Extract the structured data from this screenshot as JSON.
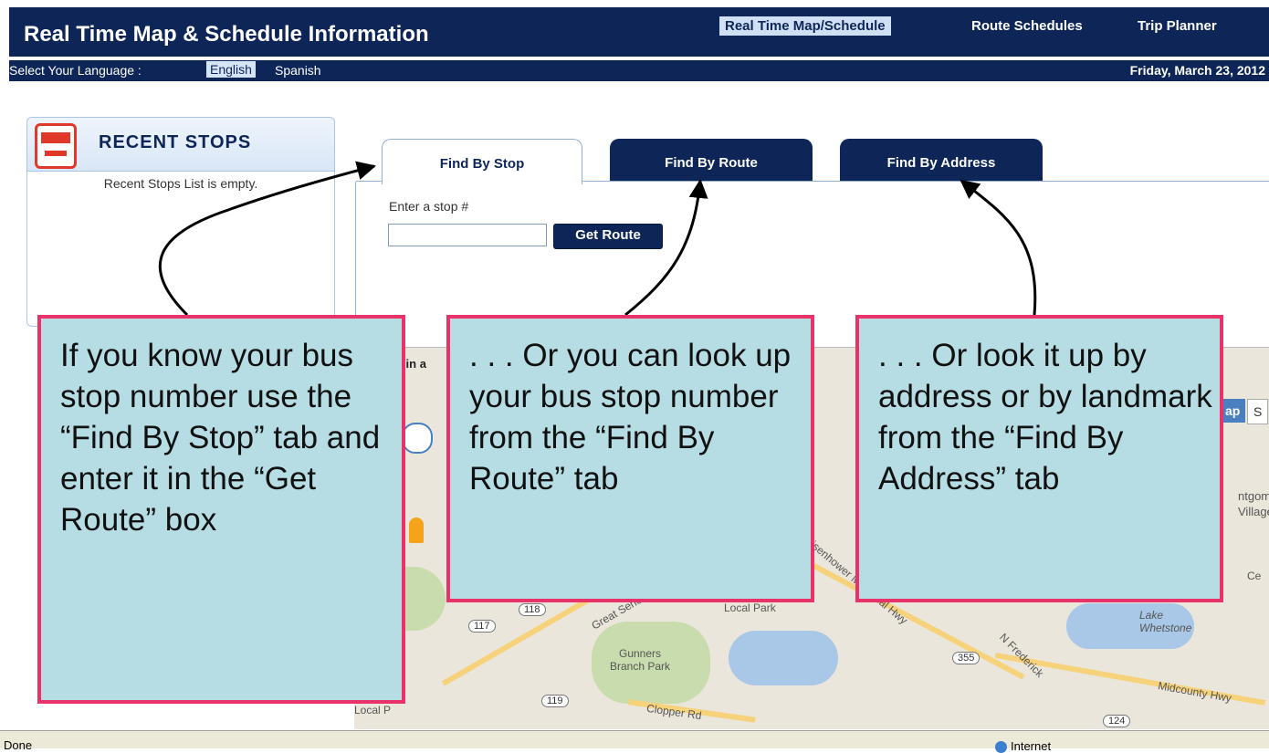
{
  "header": {
    "title": "Real Time Map & Schedule Information",
    "nav": [
      "Real Time Map/Schedule",
      "Route Schedules",
      "Trip Planner"
    ],
    "language_label": "Select Your Language :",
    "languages": [
      "English",
      "Spanish"
    ],
    "date": "Friday, March 23, 2012"
  },
  "recent_stops": {
    "title": "RECENT STOPS",
    "empty_text": "Recent Stops List is empty."
  },
  "tabs": [
    "Find By Stop",
    "Find By Route",
    "Find By Address"
  ],
  "stop_search": {
    "label": "Enter a stop #",
    "input_value": "",
    "button": "Get Route"
  },
  "map": {
    "peek_text": "n in a",
    "type_tabs": [
      "ap",
      "S"
    ],
    "labels": [
      "Gunners Branch Park",
      "Local Park",
      "Local P",
      "Lake Whetstone",
      "Midcounty Hwy",
      "Clopper Rd",
      "Dwight D. Eisenhower Memorial Hwy",
      "Great Seneca",
      "N Frederick",
      "ntgom",
      "Village",
      "Ce"
    ],
    "shields": [
      "118",
      "117",
      "119",
      "355",
      "124"
    ]
  },
  "status": {
    "left": "Done",
    "zone": "Internet"
  },
  "callouts": [
    "If you know your bus stop number use the “Find By Stop” tab and enter it in the “Get Route” box",
    ". . . Or you can look up your bus stop number from the “Find By Route” tab",
    ". . . Or look it up by address or by landmark from the “Find By Address” tab"
  ],
  "colors": {
    "navy": "#0d2657",
    "callout_fill": "#b7dde4",
    "callout_border": "#e8336a"
  }
}
